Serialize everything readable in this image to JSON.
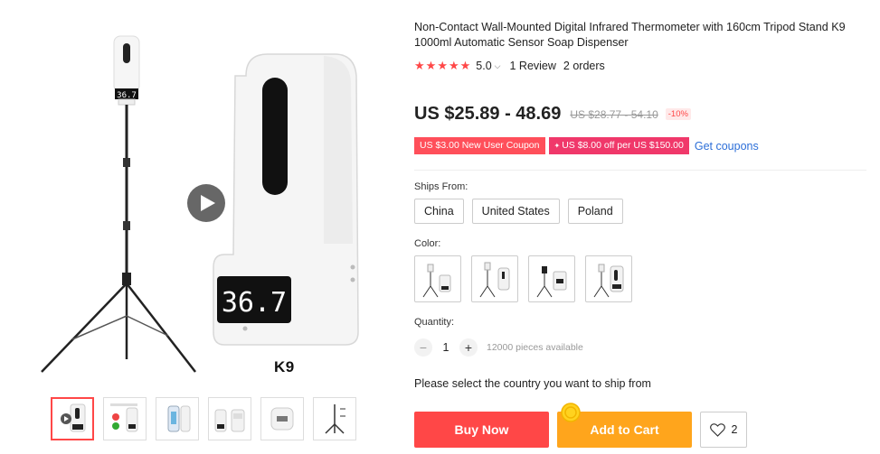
{
  "gallery": {
    "main_label": "K9",
    "display_reading": "36.7",
    "thumbs": [
      {
        "name": "thumb-1"
      },
      {
        "name": "thumb-2"
      },
      {
        "name": "thumb-3"
      },
      {
        "name": "thumb-4"
      },
      {
        "name": "thumb-5"
      },
      {
        "name": "thumb-6"
      }
    ]
  },
  "product": {
    "title": "Non-Contact Wall-Mounted Digital Infrared Thermometer with 160cm Tripod Stand K9 1000ml Automatic Sensor Soap Dispenser",
    "rating_value": "5.0",
    "rating_stars": 5,
    "reviews": "1 Review",
    "orders": "2 orders",
    "price": "US $25.89 - 48.69",
    "old_price": "US $28.77 - 54.10",
    "discount": "-10%",
    "coupons": [
      {
        "label": "US $3.00 New User Coupon"
      },
      {
        "label": "US $8.00 off per US $150.00"
      }
    ],
    "get_coupons": "Get coupons"
  },
  "options": {
    "ships_from_label": "Ships From:",
    "ships_from": [
      "China",
      "United States",
      "Poland"
    ],
    "color_label": "Color:",
    "quantity_label": "Quantity:",
    "quantity_value": "1",
    "quantity_available": "12000 pieces available",
    "ship_note": "Please select the country you want to ship from"
  },
  "actions": {
    "buy_now": "Buy Now",
    "add_to_cart": "Add to Cart",
    "wishlist_count": "2"
  },
  "colors": {
    "accent_red": "#ff4747",
    "cart_orange": "#ffa51c",
    "coupon_pink": "#f0386a",
    "link_blue": "#2d6fd8"
  }
}
